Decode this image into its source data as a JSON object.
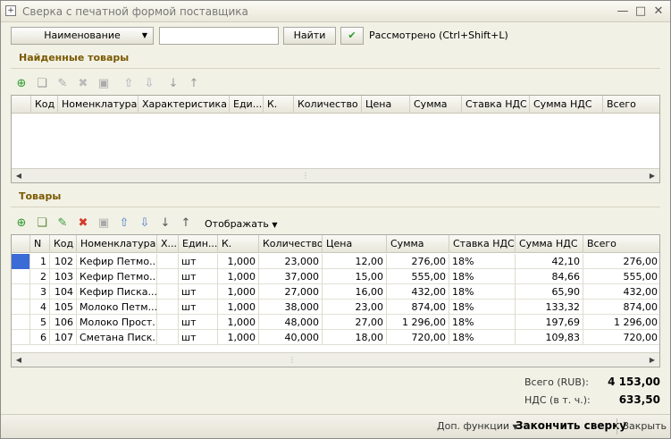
{
  "window": {
    "title": "Сверка с печатной формой поставщика"
  },
  "search": {
    "field_select": "Наименование",
    "value": "",
    "find_label": "Найти",
    "reviewed_label": "Рассмотрено (Ctrl+Shift+L)"
  },
  "found": {
    "title": "Найденные товары",
    "columns": [
      "Код",
      "Номенклатура",
      "Характеристика",
      "Еди...",
      "К.",
      "Количество",
      "Цена",
      "Сумма",
      "Ставка НДС",
      "Сумма НДС",
      "Всего"
    ]
  },
  "goods": {
    "title": "Товары",
    "display_label": "Отображать",
    "columns": [
      "N",
      "Код",
      "Номенклатура",
      "Х...",
      "Един...",
      "К.",
      "Количество",
      "Цена",
      "Сумма",
      "Ставка НДС",
      "Сумма НДС",
      "Всего"
    ],
    "rows": [
      [
        "1",
        "102",
        "Кефир Петмо...",
        "",
        "шт",
        "1,000",
        "23,000",
        "12,00",
        "276,00",
        "18%",
        "42,10",
        "276,00"
      ],
      [
        "2",
        "103",
        "Кефир Петмо...",
        "",
        "шт",
        "1,000",
        "37,000",
        "15,00",
        "555,00",
        "18%",
        "84,66",
        "555,00"
      ],
      [
        "3",
        "104",
        "Кефир Писка...",
        "",
        "шт",
        "1,000",
        "27,000",
        "16,00",
        "432,00",
        "18%",
        "65,90",
        "432,00"
      ],
      [
        "4",
        "105",
        "Молоко Петм...",
        "",
        "шт",
        "1,000",
        "38,000",
        "23,00",
        "874,00",
        "18%",
        "133,32",
        "874,00"
      ],
      [
        "5",
        "106",
        "Молоко Прост...",
        "",
        "шт",
        "1,000",
        "48,000",
        "27,00",
        "1 296,00",
        "18%",
        "197,69",
        "1 296,00"
      ],
      [
        "6",
        "107",
        "Сметана Писк...",
        "",
        "шт",
        "1,000",
        "40,000",
        "18,00",
        "720,00",
        "18%",
        "109,83",
        "720,00"
      ]
    ]
  },
  "totals": {
    "total_label": "Всего (RUB):",
    "total_value": "4 153,00",
    "vat_label": "НДС (в т. ч.):",
    "vat_value": "633,50"
  },
  "footer": {
    "more_label": "Доп. функции",
    "finish_label": "Закончить сверку",
    "close_label": "Закрыть"
  }
}
